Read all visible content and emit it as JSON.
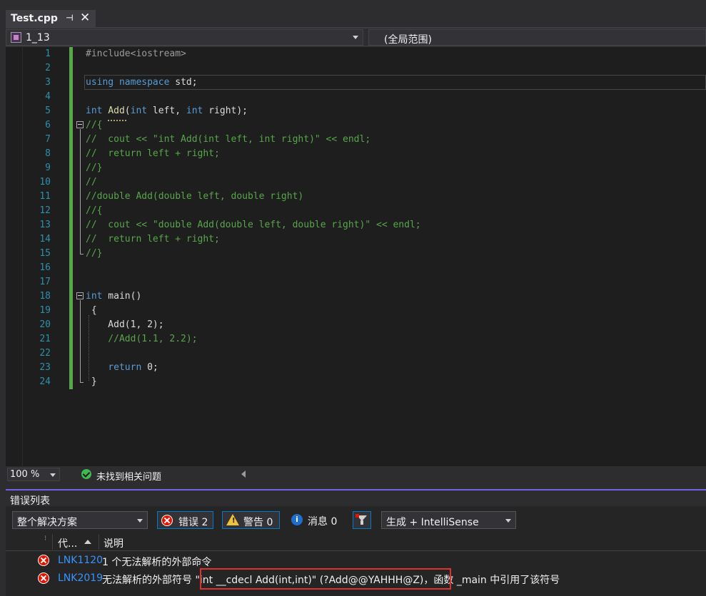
{
  "tab": {
    "title": "Test.cpp",
    "pin": "⊣",
    "close": "✕"
  },
  "navbar": {
    "project": "1_13",
    "scope": "(全局范围)"
  },
  "editor": {
    "line_numbers": [
      "1",
      "2",
      "3",
      "4",
      "5",
      "6",
      "7",
      "8",
      "9",
      "10",
      "11",
      "12",
      "13",
      "14",
      "15",
      "16",
      "17",
      "18",
      "19",
      "20",
      "21",
      "22",
      "23",
      "24"
    ],
    "lines": [
      [
        {
          "t": "#include<iostream>",
          "c": "pp"
        }
      ],
      [],
      [
        {
          "t": "using",
          "c": "kw"
        },
        {
          "t": " "
        },
        {
          "t": "namespace",
          "c": "kw"
        },
        {
          "t": " std;"
        }
      ],
      [],
      [
        {
          "t": "int",
          "c": "kw"
        },
        {
          "t": " "
        },
        {
          "t": "Add",
          "c": "fn"
        },
        {
          "t": "("
        },
        {
          "t": "int",
          "c": "kw"
        },
        {
          "t": " left, "
        },
        {
          "t": "int",
          "c": "kw"
        },
        {
          "t": " right);"
        }
      ],
      [
        {
          "t": "//{",
          "c": "cm"
        }
      ],
      [
        {
          "t": "//  cout << \"int Add(int left, int right)\" << endl;",
          "c": "cm"
        }
      ],
      [
        {
          "t": "//  return left + right;",
          "c": "cm"
        }
      ],
      [
        {
          "t": "//}",
          "c": "cm"
        }
      ],
      [
        {
          "t": "//",
          "c": "cm"
        }
      ],
      [
        {
          "t": "//double Add(double left, double right)",
          "c": "cm"
        }
      ],
      [
        {
          "t": "//{",
          "c": "cm"
        }
      ],
      [
        {
          "t": "//  cout << \"double Add(double left, double right)\" << endl;",
          "c": "cm"
        }
      ],
      [
        {
          "t": "//  return left + right;",
          "c": "cm"
        }
      ],
      [
        {
          "t": "//}",
          "c": "cm"
        }
      ],
      [],
      [],
      [
        {
          "t": "int",
          "c": "kw"
        },
        {
          "t": " main()"
        }
      ],
      [
        {
          "t": " {"
        }
      ],
      [
        {
          "t": "    Add(1, 2);"
        }
      ],
      [
        {
          "t": "    //Add(1.1, 2.2);",
          "c": "cm"
        }
      ],
      [],
      [
        {
          "t": "    "
        },
        {
          "t": "return",
          "c": "kw"
        },
        {
          "t": " 0;"
        }
      ],
      [
        {
          "t": " }"
        }
      ]
    ]
  },
  "status": {
    "zoom": "100 %",
    "issues": "未找到相关问题"
  },
  "error_list": {
    "title": "错误列表",
    "scope": "整个解决方案",
    "errors_label": "错误 2",
    "warnings_label": "警告 0",
    "messages_label": "消息 0",
    "info_glyph": "i",
    "warn_glyph": "!",
    "build_filter": "生成 + IntelliSense",
    "col_code": "代...",
    "col_desc": "说明",
    "rows": [
      {
        "code": "LNK1120",
        "desc": "1 个无法解析的外部命令"
      },
      {
        "code": "LNK2019",
        "desc": "无法解析的外部符号 \"int __cdecl Add(int,int)\" (?Add@@YAHHH@Z)，函数 _main 中引用了该符号"
      }
    ]
  },
  "colors": {
    "keyword": "#569cd6",
    "comment": "#57a64a",
    "line_number": "#2b91af",
    "error": "#e51400",
    "highlight_box": "#e03131"
  }
}
